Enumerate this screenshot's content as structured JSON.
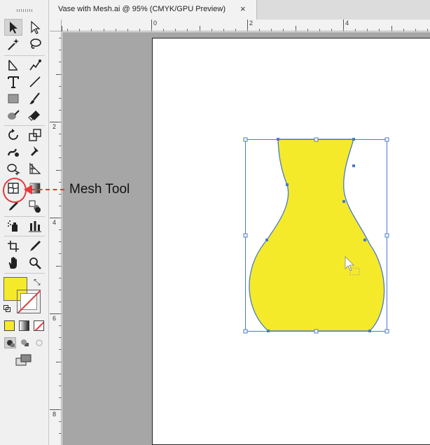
{
  "document_tab": {
    "title": "Vase with Mesh.ai @ 95% (CMYK/GPU Preview)",
    "close_glyph": "×"
  },
  "ruler": {
    "horizontal_labels": [
      "0",
      "2",
      "4"
    ],
    "vertical_labels": [
      "2",
      "4",
      "6",
      "8"
    ]
  },
  "annotation": {
    "label": "Mesh Tool",
    "color": "#e8363a"
  },
  "toolbar": {
    "tools": [
      "selection-tool",
      "direct-selection-tool",
      "magic-wand-tool",
      "lasso-tool",
      "pen-tool",
      "curvature-tool",
      "type-tool",
      "line-segment-tool",
      "rectangle-tool",
      "paintbrush-tool",
      "blob-brush-tool",
      "eraser-tool",
      "rotate-tool",
      "scale-tool",
      "warp-tool",
      "puppet-warp-tool",
      "shape-builder-tool",
      "perspective-grid-tool",
      "mesh-tool",
      "gradient-tool",
      "eyedropper-tool",
      "blend-tool",
      "symbol-sprayer-tool",
      "column-graph-tool",
      "artboard-tool",
      "slice-tool",
      "hand-tool",
      "zoom-tool"
    ],
    "selected_tool": "selection-tool",
    "fill_color": "#f5ea2a",
    "stroke": "none"
  },
  "artwork": {
    "object": "vase",
    "fill_color": "#f5ea2a",
    "outline_color": "#4a7bc8"
  }
}
